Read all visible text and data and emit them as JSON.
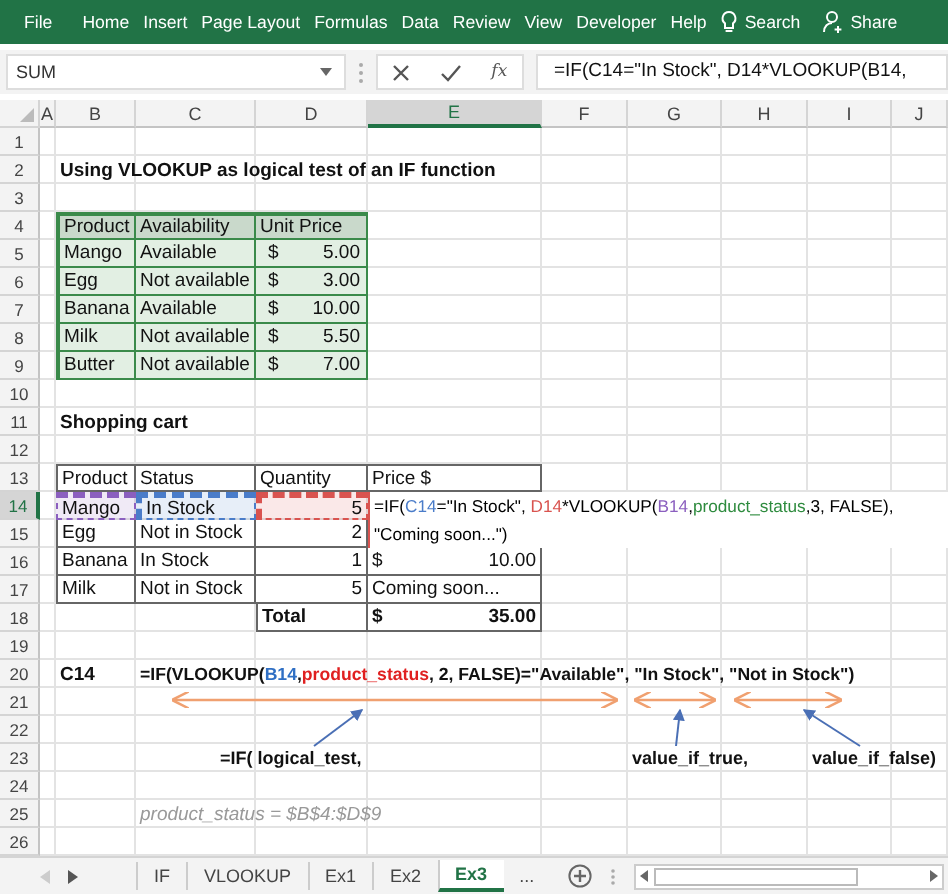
{
  "ribbon": {
    "tabs": [
      "File",
      "Home",
      "Insert",
      "Page Layout",
      "Formulas",
      "Data",
      "Review",
      "View",
      "Developer",
      "Help"
    ],
    "search": "Search",
    "share": "Share"
  },
  "formula_bar": {
    "name_box": "SUM",
    "function_label": "fx",
    "formula": "=IF(C14=\"In Stock\", D14*VLOOKUP(B14,"
  },
  "columns": [
    {
      "label": "A",
      "selected": false
    },
    {
      "label": "B",
      "selected": false
    },
    {
      "label": "C",
      "selected": false
    },
    {
      "label": "D",
      "selected": false
    },
    {
      "label": "E",
      "selected": true
    },
    {
      "label": "F",
      "selected": false
    },
    {
      "label": "G",
      "selected": false
    },
    {
      "label": "H",
      "selected": false
    },
    {
      "label": "I",
      "selected": false
    },
    {
      "label": "J",
      "selected": false
    }
  ],
  "rows": [
    {
      "label": "1",
      "selected": false
    },
    {
      "label": "2",
      "selected": false
    },
    {
      "label": "3",
      "selected": false
    },
    {
      "label": "4",
      "selected": false
    },
    {
      "label": "5",
      "selected": false
    },
    {
      "label": "6",
      "selected": false
    },
    {
      "label": "7",
      "selected": false
    },
    {
      "label": "8",
      "selected": false
    },
    {
      "label": "9",
      "selected": false
    },
    {
      "label": "10",
      "selected": false
    },
    {
      "label": "11",
      "selected": false
    },
    {
      "label": "12",
      "selected": false
    },
    {
      "label": "13",
      "selected": false
    },
    {
      "label": "14",
      "selected": true
    },
    {
      "label": "15",
      "selected": false
    },
    {
      "label": "16",
      "selected": false
    },
    {
      "label": "17",
      "selected": false
    },
    {
      "label": "18",
      "selected": false
    },
    {
      "label": "19",
      "selected": false
    },
    {
      "label": "20",
      "selected": false
    },
    {
      "label": "21",
      "selected": false
    },
    {
      "label": "22",
      "selected": false
    },
    {
      "label": "23",
      "selected": false
    },
    {
      "label": "24",
      "selected": false
    },
    {
      "label": "25",
      "selected": false
    },
    {
      "label": "26",
      "selected": false
    }
  ],
  "title": "Using VLOOKUP as logical test of an IF function",
  "lookup_table": {
    "columns": [
      "Product",
      "Availability",
      "Unit Price"
    ],
    "rows": [
      {
        "product": "Mango",
        "availability": "Available",
        "currency": "$",
        "price": "5.00"
      },
      {
        "product": "Egg",
        "availability": "Not available",
        "currency": "$",
        "price": "3.00"
      },
      {
        "product": "Banana",
        "availability": "Available",
        "currency": "$",
        "price": "10.00"
      },
      {
        "product": "Milk",
        "availability": "Not available",
        "currency": "$",
        "price": "5.50"
      },
      {
        "product": "Butter",
        "availability": "Not available",
        "currency": "$",
        "price": "7.00"
      }
    ]
  },
  "cart_heading": "Shopping cart",
  "cart_table": {
    "columns": [
      "Product",
      "Status",
      "Quantity",
      "Price $"
    ],
    "rows": [
      {
        "cells": [
          {
            "text": "Mango",
            "color": "#8b5fbf"
          },
          {
            "text": "In Stock",
            "color": "#4a7cc9"
          },
          {
            "text": "5",
            "color": "#d9534f"
          }
        ]
      },
      {
        "cells": [
          {
            "text": "Egg"
          },
          {
            "text": "Not in Stock"
          },
          {
            "text": "2"
          }
        ]
      },
      {
        "cells": [
          {
            "text": "Banana"
          },
          {
            "text": "In Stock"
          },
          {
            "text": "1"
          }
        ],
        "price": {
          "kind": "amount",
          "currency": "$",
          "amount": "10.00"
        }
      },
      {
        "cells": [
          {
            "text": "Milk"
          },
          {
            "text": "Not in Stock"
          },
          {
            "text": "5"
          }
        ],
        "price": {
          "kind": "text",
          "text": "Coming soon..."
        }
      }
    ],
    "total": {
      "label": "Total",
      "currency": "$",
      "amount": "35.00"
    }
  },
  "editing_formula": {
    "lines": [
      [
        {
          "text": "=IF("
        },
        {
          "text": "C14",
          "color": "#4a7cc9"
        },
        {
          "text": "=\"In Stock\", "
        },
        {
          "text": "D14",
          "color": "#d9534f"
        },
        {
          "text": "*VLOOKUP("
        },
        {
          "text": "B14",
          "color": "#8b5fbf"
        },
        {
          "text": ","
        },
        {
          "text": "product_status",
          "color": "#2e8b3e"
        },
        {
          "text": ",3, FALSE),"
        }
      ],
      [
        {
          "text": "\"Coming soon...\")"
        }
      ]
    ]
  },
  "explanation": {
    "cell": "C14",
    "formula": [
      {
        "text": "=IF(VLOOKUP("
      },
      {
        "text": "B14",
        "color": "#2f6fc4"
      },
      {
        "text": ", "
      },
      {
        "text": "product_status",
        "color": "#e02020"
      },
      {
        "text": ", 2, FALSE)=\"Available\", \"In Stock\", \"Not in Stock\")"
      }
    ],
    "labels": [
      "=IF(  logical_test,",
      "value_if_true,",
      "value_if_false)"
    ],
    "note": "product_status = $B$4:$D$9"
  },
  "sheet_tabs": [
    {
      "label": "IF",
      "selected": false
    },
    {
      "label": "VLOOKUP",
      "selected": false
    },
    {
      "label": "Ex1",
      "selected": false
    },
    {
      "label": "Ex2",
      "selected": false
    },
    {
      "label": "Ex3",
      "selected": true
    }
  ],
  "more_sheets": "..."
}
